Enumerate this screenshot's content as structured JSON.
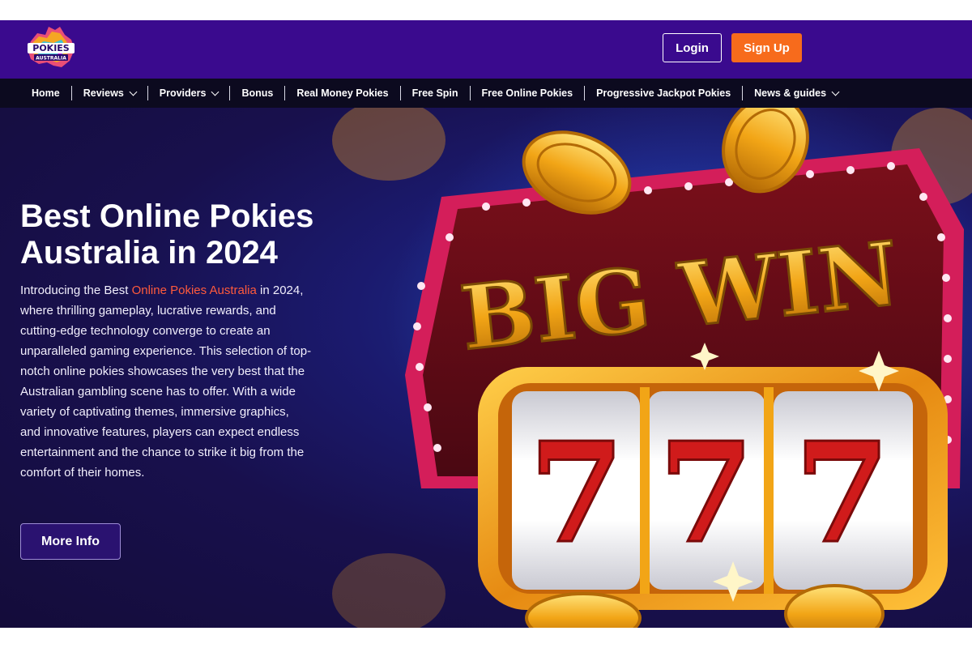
{
  "brand": {
    "logo_line1": "POKIES",
    "logo_line2": "AUSTRALIA"
  },
  "header": {
    "login_label": "Login",
    "signup_label": "Sign Up"
  },
  "nav": {
    "items": [
      {
        "label": "Home",
        "has_dropdown": false
      },
      {
        "label": "Reviews",
        "has_dropdown": true
      },
      {
        "label": "Providers",
        "has_dropdown": true
      },
      {
        "label": "Bonus",
        "has_dropdown": false
      },
      {
        "label": "Real Money Pokies",
        "has_dropdown": false
      },
      {
        "label": "Free Spin",
        "has_dropdown": false
      },
      {
        "label": "Free Online Pokies",
        "has_dropdown": false
      },
      {
        "label": "Progressive Jackpot Pokies",
        "has_dropdown": false
      },
      {
        "label": "News & guides",
        "has_dropdown": true
      }
    ]
  },
  "hero": {
    "title": "Best Online Pokies Australia in 2024",
    "intro_before": "Introducing the Best ",
    "intro_link": "Online Pokies Australia",
    "intro_after": " in 2024, where thrilling gameplay, lucrative rewards, and cutting-edge technology converge to create an unparalleled gaming experience. This selection of top-notch online pokies showcases the very best that the Australian gambling scene has to offer. With a wide variety of captivating themes, immersive graphics, and innovative features, players can expect endless entertainment and the chance to strike it big from the comfort of their homes.",
    "button_label": "More Info",
    "banner_text": "BIG WIN",
    "reel_symbols": [
      "7",
      "7",
      "7"
    ]
  },
  "colors": {
    "header_bg": "#3a0a8e",
    "nav_bg": "#0c0a1f",
    "accent_orange": "#f76b1c",
    "link_red": "#ff5a3c",
    "hero_bg": "#18104d"
  },
  "icons": {
    "dropdown": "chevron-down-icon",
    "logo": "australia-map-logo"
  }
}
